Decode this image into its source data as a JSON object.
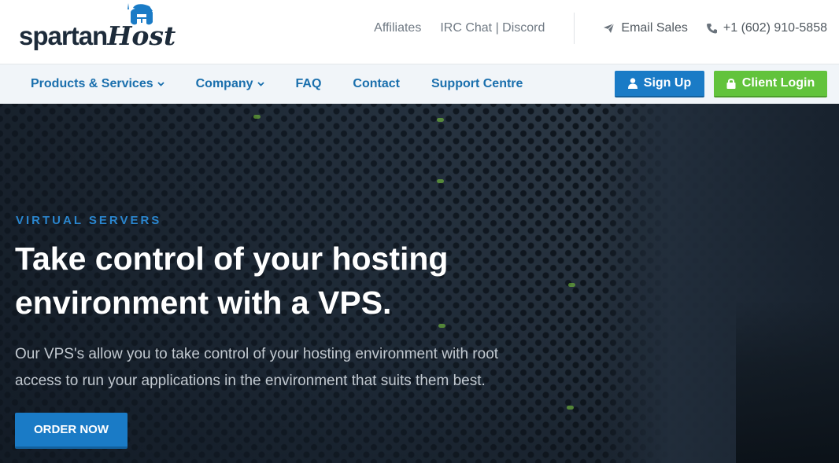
{
  "brand": {
    "name_part1": "spartan",
    "name_part2": "Host",
    "logo_icon": "spartan-helmet-icon",
    "colors": {
      "dark": "#1d2b3a",
      "accent": "#1a7bc6"
    }
  },
  "topbar": {
    "affiliates": "Affiliates",
    "irc_discord": "IRC Chat | Discord",
    "email_sales": "Email Sales",
    "phone": "+1 (602) 910-5858",
    "email_icon": "paper-plane-icon",
    "phone_icon": "phone-icon"
  },
  "nav": {
    "items": [
      {
        "label": "Products & Services",
        "has_dropdown": true
      },
      {
        "label": "Company",
        "has_dropdown": true
      },
      {
        "label": "FAQ",
        "has_dropdown": false
      },
      {
        "label": "Contact",
        "has_dropdown": false
      },
      {
        "label": "Support Centre",
        "has_dropdown": false
      }
    ],
    "signup_label": "Sign Up",
    "signup_icon": "user-icon",
    "login_label": "Client Login",
    "login_icon": "lock-icon",
    "colors": {
      "link": "#1a6fad",
      "signup": "#1a7bc6",
      "login": "#62c33c"
    }
  },
  "hero": {
    "kicker": "VIRTUAL SERVERS",
    "headline": "Take control of your hosting environment with a VPS.",
    "subtext": "Our VPS's allow you to take control of your hosting environment with root access to run your applications in the environment that suits them best.",
    "cta_label": "ORDER NOW"
  }
}
